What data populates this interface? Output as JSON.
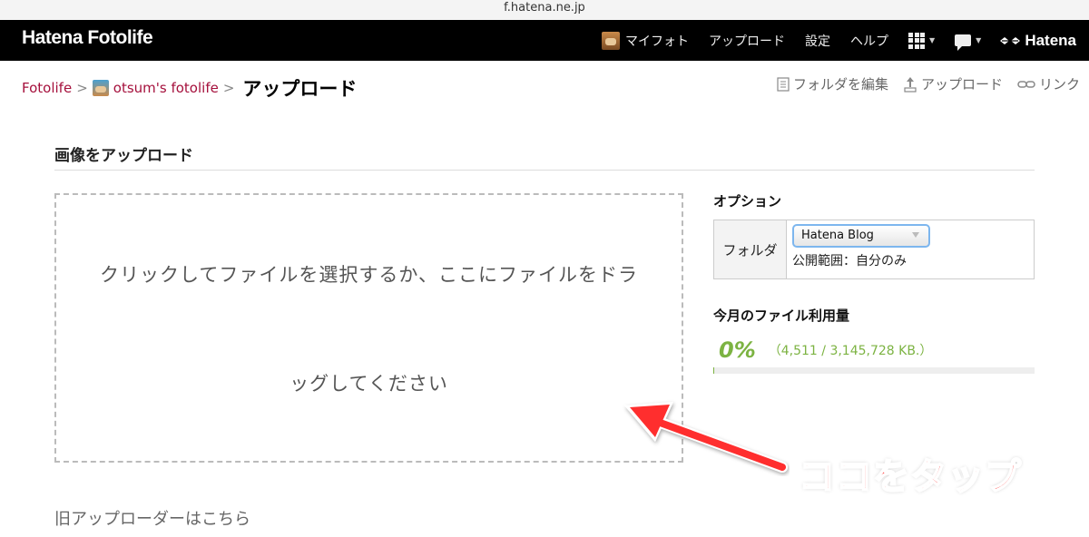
{
  "browser": {
    "url": "f.hatena.ne.jp"
  },
  "header": {
    "logo": "Hatena Fotolife",
    "nav": [
      "マイフォト",
      "アップロード",
      "設定",
      "ヘルプ"
    ],
    "brand": "Hatena"
  },
  "breadcrumb": {
    "root": "Fotolife",
    "sep": ">",
    "user": "otsum's fotolife",
    "current": "アップロード"
  },
  "tools": {
    "edit_folder": "フォルダを編集",
    "upload": "アップロード",
    "link": "リンク"
  },
  "upload": {
    "title": "画像をアップロード",
    "dropzone_line1": "クリックしてファイルを選択するか、ここにファイルをドラ",
    "dropzone_line2": "ッグしてください"
  },
  "options": {
    "title": "オプション",
    "folder_label": "フォルダ",
    "folder_selected": "Hatena Blog",
    "visibility": "公開範囲：自分のみ"
  },
  "usage": {
    "title": "今月のファイル利用量",
    "percent": "0%",
    "detail": "（4,511 / 3,145,728 KB.）",
    "fill_fraction": 0.0014
  },
  "old_uploader": "旧アップローダーはこちら",
  "annotation": {
    "text": "ココをタップ",
    "color": "#ff2d2d"
  },
  "colors": {
    "accent": "#a5103c",
    "usage_green": "#7cb342"
  }
}
